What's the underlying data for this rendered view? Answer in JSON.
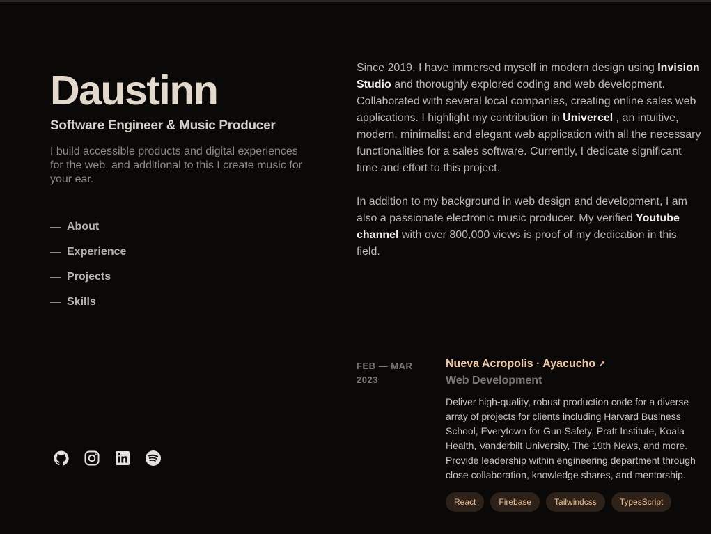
{
  "profile": {
    "name": "Daustinn",
    "role": "Software Engineer & Music Producer",
    "intro": "I build accessible products and digital experiences for the web. and additional to this I create music for your ear."
  },
  "nav": {
    "items": [
      {
        "label": "About"
      },
      {
        "label": "Experience"
      },
      {
        "label": "Projects"
      },
      {
        "label": "Skills"
      }
    ]
  },
  "socials": {
    "icons": [
      "github-icon",
      "instagram-icon",
      "linkedin-icon",
      "spotify-icon"
    ]
  },
  "about": {
    "p1_a": "Since 2019, I have immersed myself in modern design using ",
    "p1_hl1": "Invision Studio",
    "p1_b": " and thoroughly explored coding and web development. Collaborated with several local companies, creating online sales web applications. I highlight my contribution in ",
    "p1_hl2": "Univercel",
    "p1_c": " , an intuitive, modern, minimalist and elegant web application with all the necessary functionalities for a sales software. Currently, I dedicate significant time and effort to this project.",
    "p2_a": "In addition to my background in web design and development, I am also a passionate electronic music producer. My verified ",
    "p2_hl": "Youtube channel",
    "p2_b": " with over 800,000 views is proof of my dedication in this field."
  },
  "experience": {
    "date": "FEB — MAR 2023",
    "title": "Nueva Acropolis · Ayacucho",
    "arrow": "↗",
    "subtitle": "Web Development",
    "description": "Deliver high-quality, robust production code for a diverse array of projects for clients including Harvard Business School, Everytown for Gun Safety, Pratt Institute, Koala Health, Vanderbilt University, The 19th News, and more. Provide leadership within engineering department through close collaboration, knowledge shares, and mentorship.",
    "tags": [
      "React",
      "Firebase",
      "Tailwindcss",
      "TypesScript"
    ]
  },
  "colors": {
    "background": "#0b0908",
    "name": "#e2d8cc",
    "accent": "#f0c9a0",
    "tag_bg": "#2d2219",
    "tag_text": "#f0bd8c"
  }
}
